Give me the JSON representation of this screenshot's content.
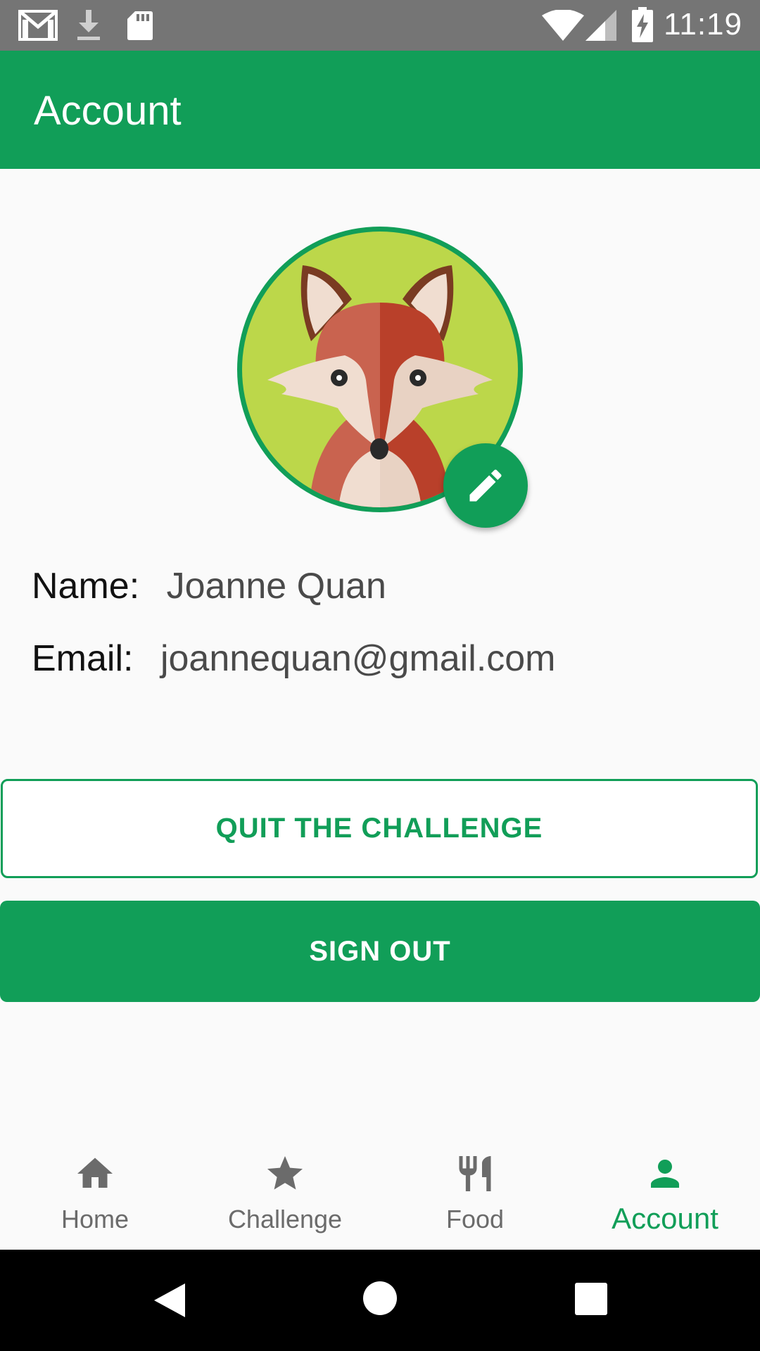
{
  "status_bar": {
    "time": "11:19",
    "left_icons": [
      "gmail-icon",
      "download-icon",
      "sd-card-icon"
    ],
    "right_icons": [
      "wifi-icon",
      "signal-icon",
      "battery-charging-icon"
    ]
  },
  "app_bar": {
    "title": "Account"
  },
  "profile": {
    "avatar": "fox-avatar",
    "edit_icon": "pencil-icon",
    "name_label": "Name:",
    "name_value": "Joanne Quan",
    "email_label": "Email:",
    "email_value": "joannequan@gmail.com"
  },
  "buttons": {
    "quit": "QUIT THE CHALLENGE",
    "sign_out": "SIGN OUT"
  },
  "bottom_nav": {
    "items": [
      {
        "label": "Home",
        "icon": "home-icon",
        "active": false
      },
      {
        "label": "Challenge",
        "icon": "star-icon",
        "active": false
      },
      {
        "label": "Food",
        "icon": "fork-knife-icon",
        "active": false
      },
      {
        "label": "Account",
        "icon": "person-icon",
        "active": true
      }
    ]
  },
  "colors": {
    "primary": "#119e58",
    "status_bar": "#757575",
    "inactive_nav": "#6b6b6b",
    "avatar_background": "#bcd74a"
  }
}
